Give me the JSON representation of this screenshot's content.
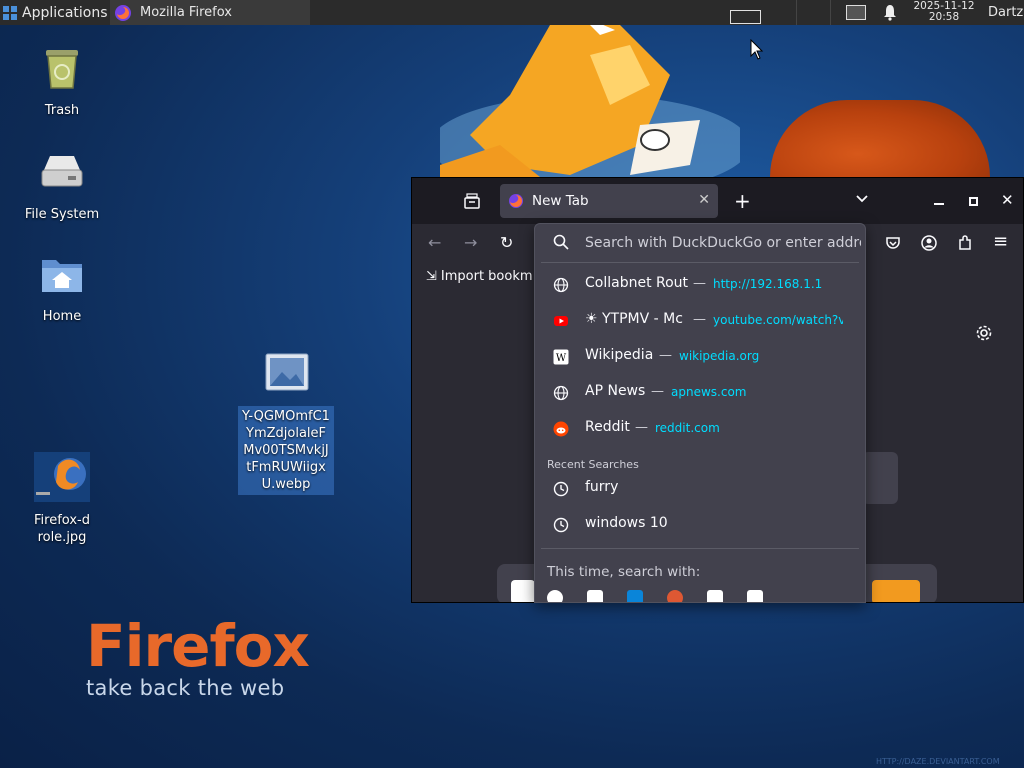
{
  "panel": {
    "applications_label": "Applications",
    "task_title": "Mozilla Firefox",
    "clock_date": "2025-11-12",
    "clock_time": "20:58",
    "user": "Dartz"
  },
  "desktop": {
    "trash_label": "Trash",
    "filesystem_label": "File System",
    "home_label": "Home",
    "firefox_file_label": "Firefox-drole.jpg",
    "image_file_label": "Y-QGMOmfC1YmZdjolaleFMv00TSMvkjJtFmRUWiigxU.webp"
  },
  "wallpaper": {
    "brand": "Firefox",
    "tagline": "take back the web",
    "watermark": "HTTP://DAZE.DEVIANTART.COM"
  },
  "browser": {
    "tab_title": "New Tab",
    "import_bookmarks": "Import bookm",
    "url_placeholder": "Search with DuckDuckGo or enter address",
    "suggestions": [
      {
        "title": "Collabnet Rout",
        "url": "http://192.168.1.1",
        "icon": "globe-icon"
      },
      {
        "title": "☀ YTPMV - Mc",
        "url": "youtube.com/watch?v",
        "icon": "youtube-icon"
      },
      {
        "title": "Wikipedia",
        "url": "wikipedia.org",
        "icon": "wikipedia-icon"
      },
      {
        "title": "AP News",
        "url": "apnews.com",
        "icon": "globe-icon"
      },
      {
        "title": "Reddit",
        "url": "reddit.com",
        "icon": "reddit-icon"
      }
    ],
    "recent_searches_header": "Recent Searches",
    "recent_searches": [
      "furry",
      "windows 10"
    ],
    "search_with_label": "This time, search with:",
    "colors": {
      "accent_url": "#00ddff",
      "tab_bg": "#42414d",
      "toolbar_bg": "#2b2a33",
      "frame_bg": "#1c1b22"
    }
  }
}
